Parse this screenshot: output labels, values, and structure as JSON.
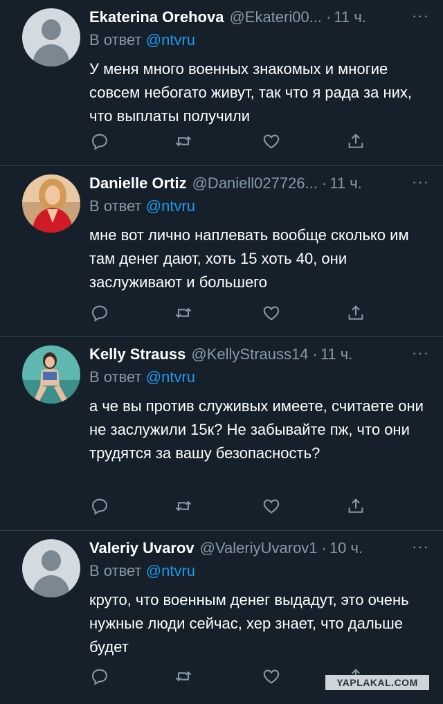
{
  "tweets": [
    {
      "name": "Ekaterina Orehova",
      "handle": "@Ekateri00...",
      "time": "11 ч.",
      "reply_prefix": "В ответ",
      "reply_to": "@ntvru",
      "text": "У меня много военных знакомых и многие совсем небогато живут, так что я рада за них, что выплаты получили",
      "avatar": "default-avatar"
    },
    {
      "name": "Danielle Ortiz",
      "handle": "@Daniell027726...",
      "time": "11 ч.",
      "reply_prefix": "В ответ",
      "reply_to": "@ntvru",
      "text": "мне вот лично наплевать вообще сколько им там денег дают, хоть 15 хоть 40, они заслуживают и большего",
      "avatar": "photo-avatar"
    },
    {
      "name": "Kelly Strauss",
      "handle": "@KellyStrauss14",
      "time": "11 ч.",
      "reply_prefix": "В ответ",
      "reply_to": "@ntvru",
      "text": "а че вы против служивых имеете, считаете они не заслужили 15к? Не забывайте пж, что они трудятся за вашу безопасность?",
      "avatar": "photo-avatar"
    },
    {
      "name": "Valeriy Uvarov",
      "handle": "@ValeriyUvarov1",
      "time": "10 ч.",
      "reply_prefix": "В ответ",
      "reply_to": "@ntvru",
      "text": "круто, что военным денег выдадут, это очень нужные люди сейчас, хер знает, что дальше будет",
      "avatar": "default-avatar"
    }
  ],
  "more_label": "···",
  "watermark": "YAPLAKAL.COM",
  "colors": {
    "background": "#15202b",
    "secondary_text": "#8899a6",
    "mention": "#1d9bf0",
    "divider": "#38444d"
  }
}
